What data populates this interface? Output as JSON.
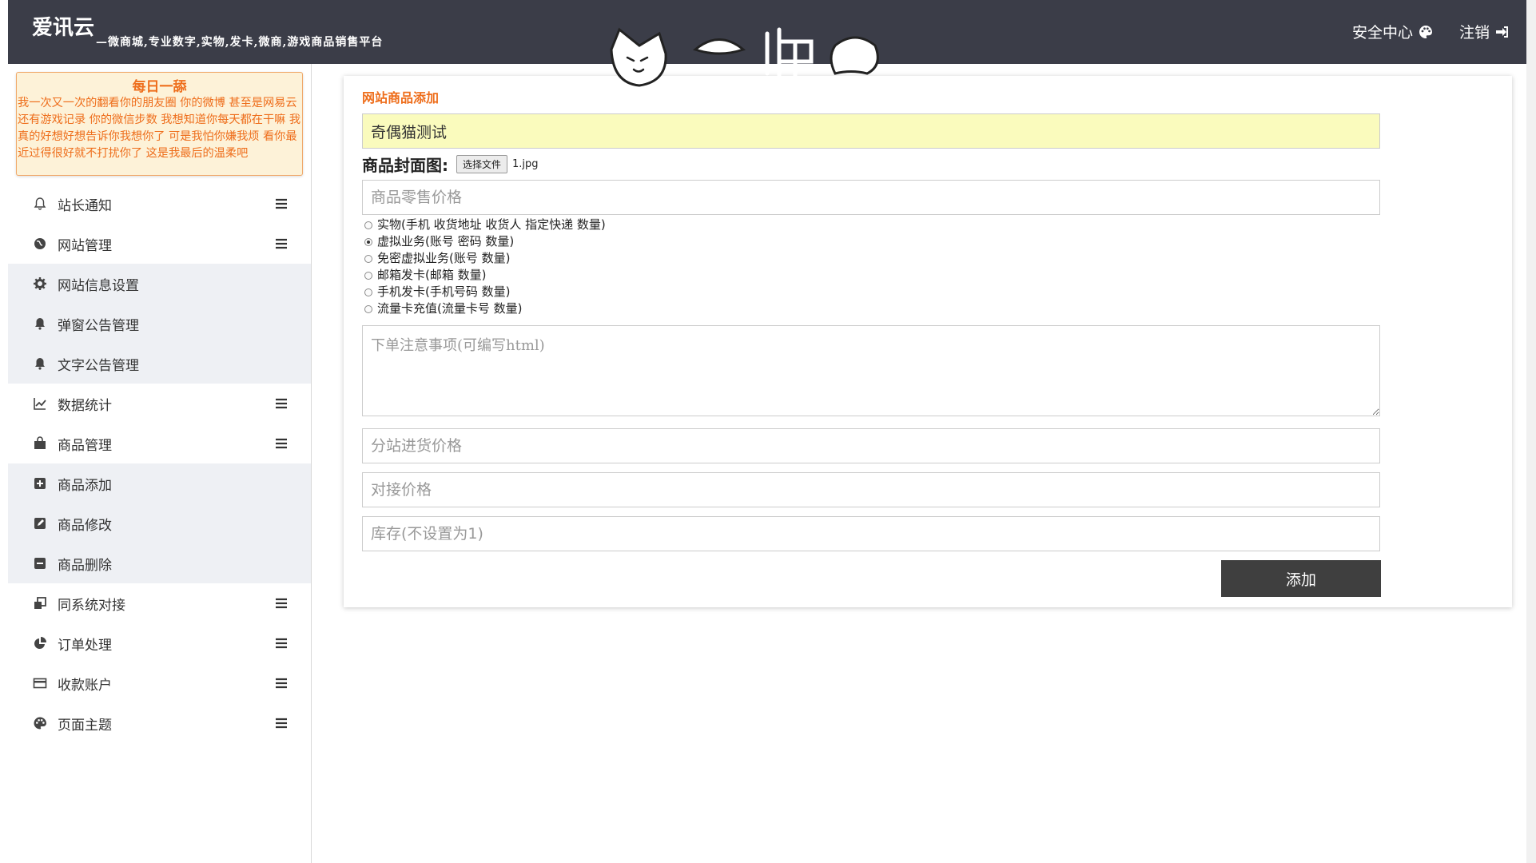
{
  "header": {
    "brand": "爱讯云",
    "slogan": "—微商城,专业数字,实物,发卡,微商,游戏商品销售平台",
    "security_center": "安全中心",
    "logout": "注销"
  },
  "notice": {
    "title": "每日一舔",
    "text": "我一次又一次的翻看你的朋友圈 你的微博 甚至是网易云 还有游戏记录 你的微信步数 我想知道你每天都在干嘛 我真的好想好想告诉你我想你了 可是我怕你嫌我烦 看你最近过得很好就不打扰你了 这是我最后的温柔吧"
  },
  "sidebar": {
    "items": [
      {
        "label": "站长通知",
        "icon": "bell-outline-icon"
      },
      {
        "label": "网站管理",
        "icon": "globe-icon"
      },
      {
        "label": "网站信息设置",
        "icon": "gear-icon"
      },
      {
        "label": "弹窗公告管理",
        "icon": "bell-icon"
      },
      {
        "label": "文字公告管理",
        "icon": "bell-icon"
      },
      {
        "label": "数据统计",
        "icon": "line-chart-icon"
      },
      {
        "label": "商品管理",
        "icon": "shopping-bag-icon"
      },
      {
        "label": "商品添加",
        "icon": "plus-square-icon"
      },
      {
        "label": "商品修改",
        "icon": "edit-square-icon"
      },
      {
        "label": "商品删除",
        "icon": "minus-square-icon"
      },
      {
        "label": "同系统对接",
        "icon": "clone-icon"
      },
      {
        "label": "订单处理",
        "icon": "pie-chart-icon"
      },
      {
        "label": "收款账户",
        "icon": "credit-card-icon"
      },
      {
        "label": "页面主题",
        "icon": "palette-icon"
      }
    ]
  },
  "form": {
    "title": "网站商品添加",
    "product_name": "奇偶猫测试",
    "cover_label": "商品封面图:",
    "file_button": "选择文件",
    "file_name": "1.jpg",
    "retail_price_placeholder": "商品零售价格",
    "radio_options": [
      "实物(手机 收货地址 收货人 指定快递 数量)",
      "虚拟业务(账号 密码 数量)",
      "免密虚拟业务(账号 数量)",
      "邮箱发卡(邮箱 数量)",
      "手机发卡(手机号码 数量)",
      "流量卡充值(流量卡号 数量)"
    ],
    "notes_placeholder": "下单注意事项(可编写html)",
    "substation_price_placeholder": "分站进货价格",
    "docking_price_placeholder": "对接价格",
    "stock_placeholder": "库存(不设置为1)",
    "add_button": "添加"
  }
}
